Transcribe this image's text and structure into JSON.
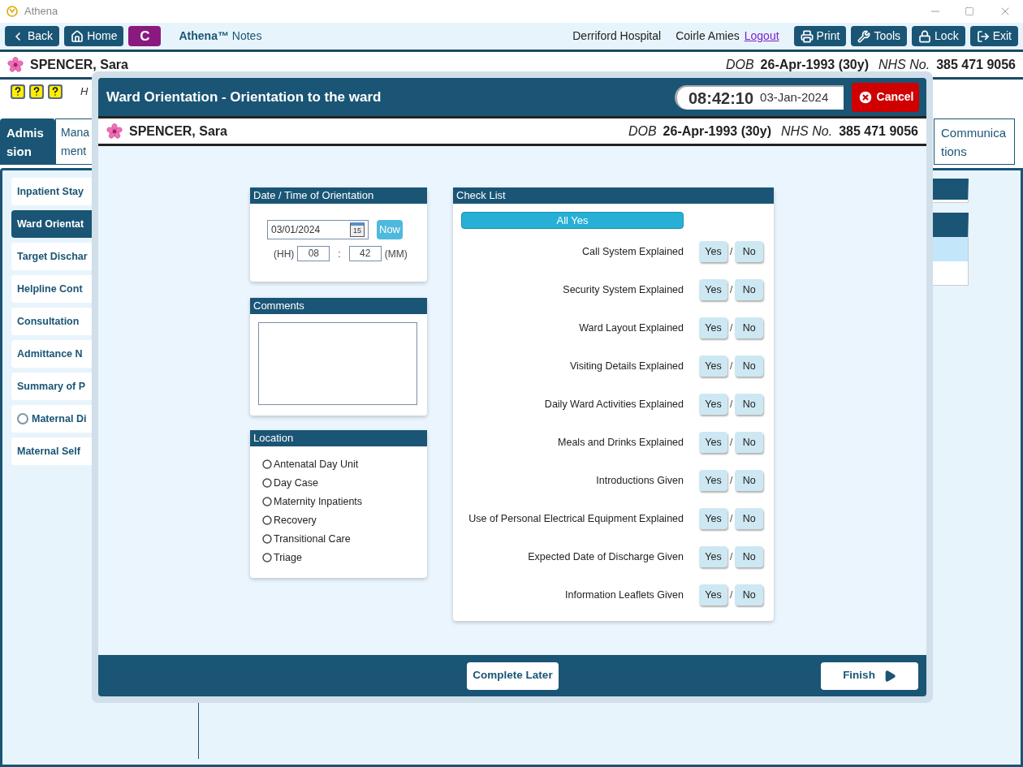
{
  "window": {
    "title": "Athena"
  },
  "toolbar": {
    "buttons": [
      {
        "kind": "back",
        "label": "Back"
      },
      {
        "kind": "home",
        "label": "Home"
      },
      {
        "kind": "letter",
        "label": "C"
      }
    ],
    "app_name": "**Athena™** Notes",
    "hospital": "Derriford Hospital",
    "user": "Coirle Amies",
    "logout": "Logout",
    "actions": [
      {
        "kind": "print",
        "label": "Print"
      },
      {
        "kind": "tools",
        "label": "Tools"
      },
      {
        "kind": "lock",
        "label": "Lock"
      },
      {
        "kind": "exit",
        "label": "Exit"
      }
    ]
  },
  "patient": {
    "name": "SPENCER, Sara",
    "dob_label": "DOB",
    "dob": "26-Apr-1993 (30y)",
    "nhs_label": "NHS No.",
    "nhs": "385 471 9056"
  },
  "info_row": {
    "text": "H"
  },
  "tabs": [
    {
      "lines": [
        "Admis",
        "sion"
      ],
      "selected": true
    },
    {
      "lines": [
        "Mana",
        "ment"
      ],
      "selected": false
    },
    {
      "lines": [
        "Communica",
        "tions"
      ],
      "selected": false
    }
  ],
  "sidebar": {
    "items": [
      {
        "label": "Inpatient Stay",
        "kind": "plain",
        "selected": false
      },
      {
        "label": "Ward Orientat",
        "kind": "plain",
        "selected": true
      },
      {
        "label": "Target Dischar",
        "kind": "plain",
        "selected": false
      },
      {
        "label": "Helpline Cont",
        "kind": "plain",
        "selected": false
      },
      {
        "label": "Consultation",
        "kind": "plain",
        "selected": false
      },
      {
        "label": "Admittance N",
        "kind": "plain",
        "selected": false
      },
      {
        "label": "Summary of P",
        "kind": "plain",
        "selected": false
      },
      {
        "label": "Maternal Di",
        "kind": "radio",
        "selected": false
      },
      {
        "label": "Maternal Self",
        "kind": "plain",
        "selected": false
      }
    ]
  },
  "dialog": {
    "title": "Ward Orientation - Orientation to the ward",
    "time": "08:42:10",
    "date": "03-Jan-2024",
    "cancel": "Cancel",
    "patient": {
      "name": "SPENCER, Sara",
      "dob_label": "DOB",
      "dob": "26-Apr-1993 (30y)",
      "nhs_label": "NHS No.",
      "nhs": "385 471 9056"
    },
    "datetime": {
      "title": "Date / Time of Orientation",
      "date_value": "03/01/2024",
      "calendar_day": "15",
      "now": "Now",
      "hh_label": "(HH)",
      "hh": "08",
      "sep": ":",
      "mm": "42",
      "mm_label": "(MM)"
    },
    "comments": {
      "title": "Comments"
    },
    "location": {
      "title": "Location",
      "options": [
        {
          "label": "Antenatal Day Unit",
          "selected": false
        },
        {
          "label": "Day Case",
          "selected": false
        },
        {
          "label": "Maternity Inpatients",
          "selected": false
        },
        {
          "label": "Recovery",
          "selected": false
        },
        {
          "label": "Transitional Care",
          "selected": false
        },
        {
          "label": "Triage",
          "selected": false
        }
      ]
    },
    "checklist": {
      "title": "Check List",
      "all_yes": "All Yes",
      "separator": "/",
      "items": [
        {
          "label": "Call System Explained",
          "options": [
            {
              "label": "Yes",
              "selected": false
            },
            {
              "label": "No",
              "selected": false
            }
          ]
        },
        {
          "label": "Security System Explained",
          "options": [
            {
              "label": "Yes",
              "selected": false
            },
            {
              "label": "No",
              "selected": false
            }
          ]
        },
        {
          "label": "Ward Layout Explained",
          "options": [
            {
              "label": "Yes",
              "selected": false
            },
            {
              "label": "No",
              "selected": false
            }
          ]
        },
        {
          "label": "Visiting Details Explained",
          "options": [
            {
              "label": "Yes",
              "selected": false
            },
            {
              "label": "No",
              "selected": false
            }
          ]
        },
        {
          "label": "Daily Ward Activities Explained",
          "options": [
            {
              "label": "Yes",
              "selected": false
            },
            {
              "label": "No",
              "selected": false
            }
          ]
        },
        {
          "label": "Meals and Drinks Explained",
          "options": [
            {
              "label": "Yes",
              "selected": false
            },
            {
              "label": "No",
              "selected": false
            }
          ]
        },
        {
          "label": "Introductions Given",
          "options": [
            {
              "label": "Yes",
              "selected": false
            },
            {
              "label": "No",
              "selected": false
            }
          ]
        },
        {
          "label": "Use of Personal Electrical Equipment Explained",
          "options": [
            {
              "label": "Yes",
              "selected": false
            },
            {
              "label": "No",
              "selected": false
            }
          ]
        },
        {
          "label": "Expected Date of Discharge Given",
          "options": [
            {
              "label": "Yes",
              "selected": false
            },
            {
              "label": "No",
              "selected": false
            }
          ]
        },
        {
          "label": "Information Leaflets Given",
          "options": [
            {
              "label": "Yes",
              "selected": false
            },
            {
              "label": "No",
              "selected": false
            }
          ]
        }
      ]
    },
    "footer": {
      "complete_later": "Complete Later",
      "finish": "Finish"
    }
  }
}
